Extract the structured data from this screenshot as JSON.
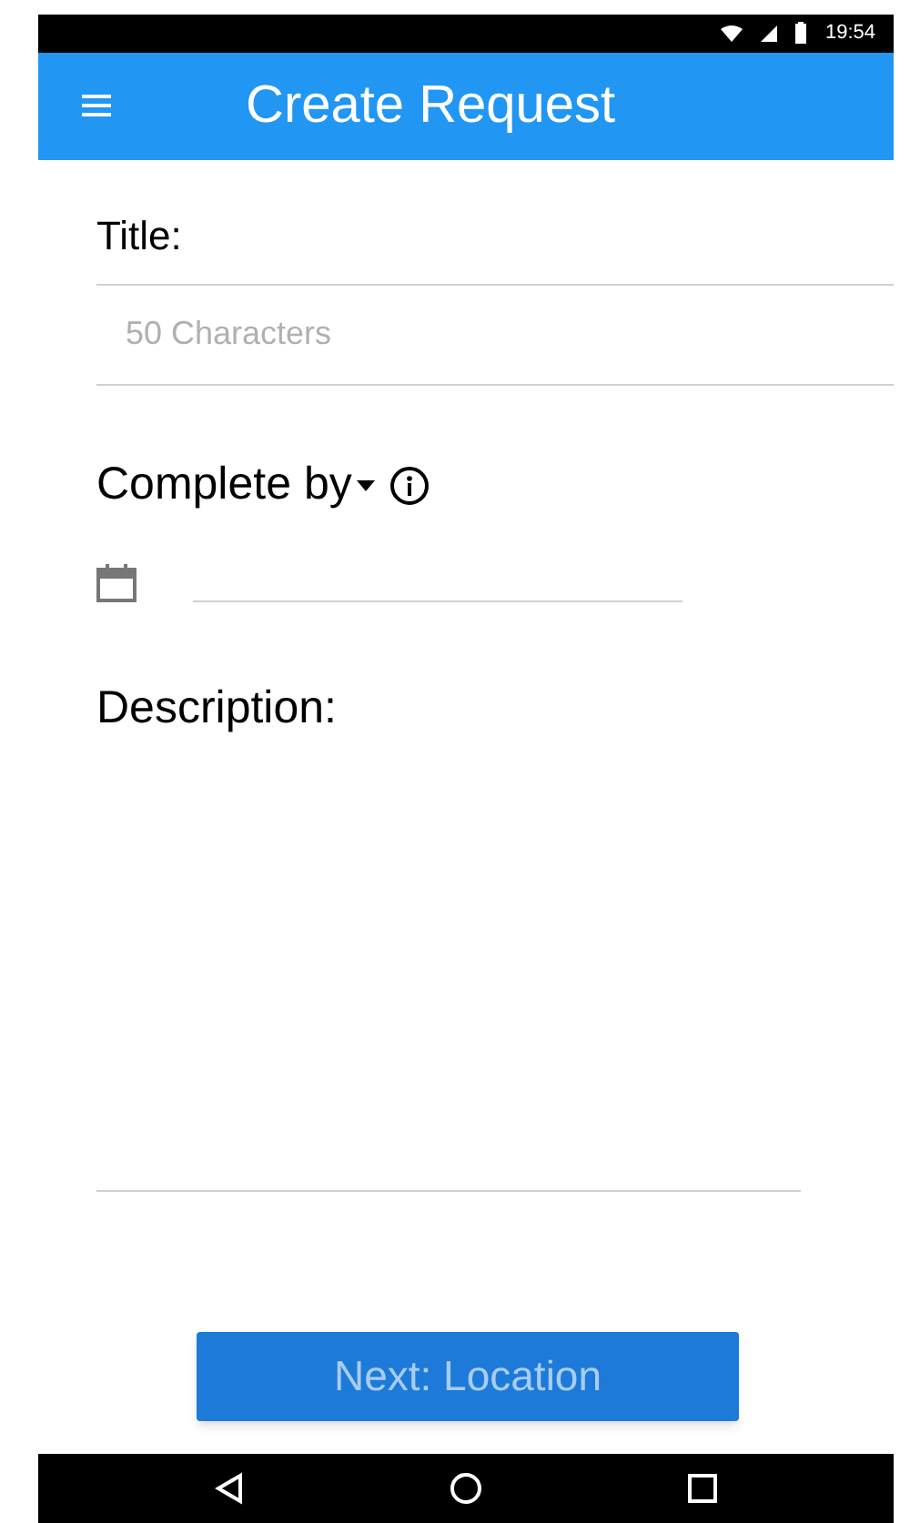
{
  "status_bar": {
    "time": "19:54"
  },
  "app_bar": {
    "title": "Create Request"
  },
  "form": {
    "title_label": "Title:",
    "title_field": {
      "placeholder": "50 Characters"
    },
    "complete_by_label": "Complete by",
    "description_label": "Description:"
  },
  "next_button": {
    "label": "Next: Location",
    "disabled": true
  }
}
